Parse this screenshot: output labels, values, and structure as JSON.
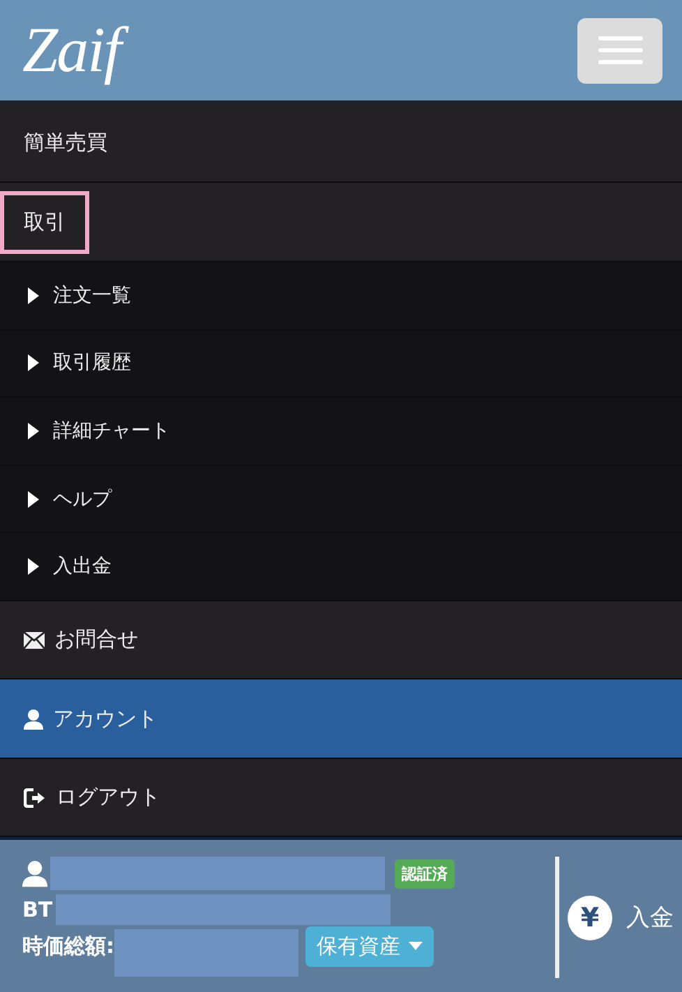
{
  "header": {
    "logo": "Zaif"
  },
  "menu": [
    {
      "kind": "section",
      "label": "簡単売買",
      "highlighted": false,
      "selected": false
    },
    {
      "kind": "section",
      "label": "取引",
      "highlighted": true,
      "selected": false
    },
    {
      "kind": "sub",
      "label": "注文一覧",
      "highlighted": false,
      "selected": false
    },
    {
      "kind": "sub",
      "label": "取引履歴",
      "highlighted": false,
      "selected": false
    },
    {
      "kind": "sub",
      "label": "詳細チャート",
      "highlighted": false,
      "selected": false
    },
    {
      "kind": "sub",
      "label": "ヘルプ",
      "highlighted": false,
      "selected": false
    },
    {
      "kind": "sub",
      "label": "入出金",
      "highlighted": false,
      "selected": false
    },
    {
      "kind": "mail",
      "label": "お問合せ",
      "highlighted": false,
      "selected": false
    },
    {
      "kind": "user",
      "label": "アカウント",
      "highlighted": false,
      "selected": true
    },
    {
      "kind": "logout",
      "label": "ログアウト",
      "highlighted": false,
      "selected": false
    }
  ],
  "account": {
    "badge": "認証済",
    "name_redacted": true,
    "line_2": "BT",
    "line_2_redacted": true,
    "total_label": "時価総額:",
    "total_redacted": true,
    "assets_button": "保有資産",
    "deposit_symbol": "¥",
    "deposit_label": "入金"
  }
}
